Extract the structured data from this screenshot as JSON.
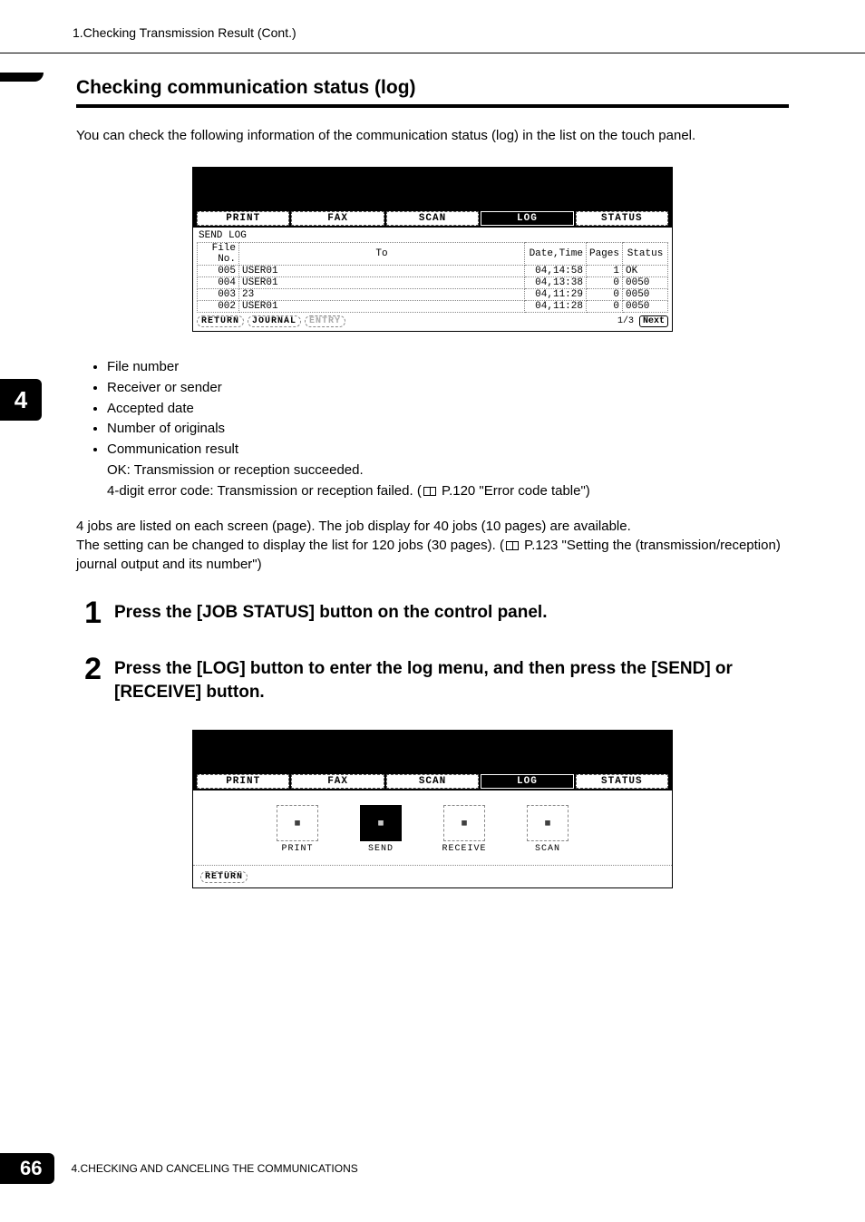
{
  "header": {
    "breadcrumb": "1.Checking Transmission Result (Cont.)"
  },
  "section": {
    "title": "Checking communication status (log)",
    "intro": "You can check the following information of the communication status (log) in the list on the touch panel."
  },
  "lcd1": {
    "tabs": [
      "PRINT",
      "FAX",
      "SCAN",
      "LOG",
      "STATUS"
    ],
    "active_tab_index": 3,
    "subtitle": "SEND LOG",
    "columns": [
      "File No.",
      "To",
      "Date,Time",
      "Pages",
      "Status"
    ],
    "rows": [
      {
        "file": "005",
        "to": "USER01",
        "date": "04,14:58",
        "pages": "1",
        "status": "OK"
      },
      {
        "file": "004",
        "to": "USER01",
        "date": "04,13:38",
        "pages": "0",
        "status": "0050"
      },
      {
        "file": "003",
        "to": "23",
        "date": "04,11:29",
        "pages": "0",
        "status": "0050"
      },
      {
        "file": "002",
        "to": "USER01",
        "date": "04,11:28",
        "pages": "0",
        "status": "0050"
      }
    ],
    "foot": {
      "return": "RETURN",
      "journal": "JOURNAL",
      "entry": "ENTRY",
      "page": "1/3",
      "next": "Next"
    }
  },
  "bullets": {
    "items": [
      "File number",
      "Receiver or sender",
      "Accepted date",
      "Number of originals",
      "Communication result"
    ],
    "sub1": "OK: Transmission or reception succeeded.",
    "sub2a": "4-digit error code: Transmission or reception failed. (",
    "sub2b": " P.120 \"Error code table\")"
  },
  "paragraph": {
    "l1": "4 jobs are listed on each screen (page). The job display for 40 jobs (10 pages) are available.",
    "l2a": "The setting can be changed to display the list for 120 jobs (30 pages). (",
    "l2b": " P.123 \"Setting the (transmission/reception) journal output and its number\")"
  },
  "chapter": {
    "number": "4"
  },
  "steps": {
    "s1": "Press the [JOB STATUS] button on the control panel.",
    "s2": "Press the [LOG] button to enter the log menu, and then press the [SEND] or [RECEIVE] button."
  },
  "lcd2": {
    "tabs": [
      "PRINT",
      "FAX",
      "SCAN",
      "LOG",
      "STATUS"
    ],
    "active_tab_index": 3,
    "icons": [
      "PRINT",
      "SEND",
      "RECEIVE",
      "SCAN"
    ],
    "active_icon_index": 1,
    "return": "RETURN"
  },
  "footer": {
    "page_number": "66",
    "chapter_label": "4.CHECKING AND CANCELING THE COMMUNICATIONS"
  }
}
